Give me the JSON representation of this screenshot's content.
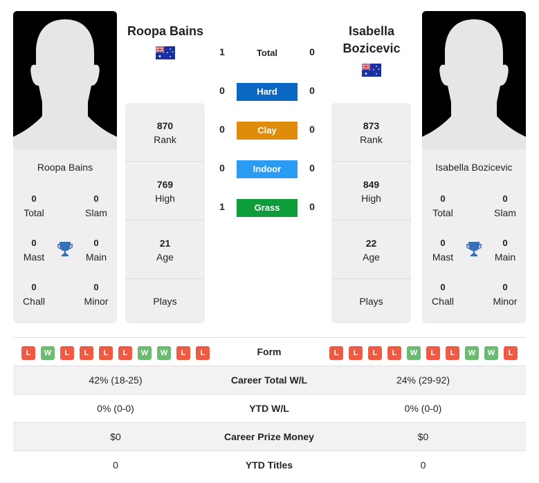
{
  "colors": {
    "hard": "#0a67c2",
    "clay": "#e08c0b",
    "indoor": "#2b9cf4",
    "grass": "#0f9d3c",
    "loss": "#ee5b45",
    "win": "#6dbb73",
    "trophy": "#3a6fba"
  },
  "player1": {
    "name": "Roopa Bains",
    "card_name": "Roopa Bains",
    "country_flag": "australia-flag",
    "rank": "870",
    "rank_label": "Rank",
    "high": "769",
    "high_label": "High",
    "age": "21",
    "age_label": "Age",
    "plays_label": "Plays",
    "titles": {
      "total": "0",
      "total_label": "Total",
      "slam": "0",
      "slam_label": "Slam",
      "mast": "0",
      "mast_label": "Mast",
      "main": "0",
      "main_label": "Main",
      "chall": "0",
      "chall_label": "Chall",
      "minor": "0",
      "minor_label": "Minor"
    },
    "form": [
      "L",
      "W",
      "L",
      "L",
      "L",
      "L",
      "W",
      "W",
      "L",
      "L"
    ],
    "career_wl": "42% (18-25)",
    "ytd_wl": "0% (0-0)",
    "prize": "$0",
    "ytd_titles": "0"
  },
  "player2": {
    "name_line1": "Isabella",
    "name_line2": "Bozicevic",
    "card_name": "Isabella Bozicevic",
    "country_flag": "australia-flag",
    "rank": "873",
    "rank_label": "Rank",
    "high": "849",
    "high_label": "High",
    "age": "22",
    "age_label": "Age",
    "plays_label": "Plays",
    "titles": {
      "total": "0",
      "total_label": "Total",
      "slam": "0",
      "slam_label": "Slam",
      "mast": "0",
      "mast_label": "Mast",
      "main": "0",
      "main_label": "Main",
      "chall": "0",
      "chall_label": "Chall",
      "minor": "0",
      "minor_label": "Minor"
    },
    "form": [
      "L",
      "L",
      "L",
      "L",
      "W",
      "L",
      "L",
      "W",
      "W",
      "L"
    ],
    "career_wl": "24% (29-92)",
    "ytd_wl": "0% (0-0)",
    "prize": "$0",
    "ytd_titles": "0"
  },
  "h2h": {
    "total": {
      "label": "Total",
      "p1": "1",
      "p2": "0"
    },
    "hard": {
      "label": "Hard",
      "p1": "0",
      "p2": "0"
    },
    "clay": {
      "label": "Clay",
      "p1": "0",
      "p2": "0"
    },
    "indoor": {
      "label": "Indoor",
      "p1": "0",
      "p2": "0"
    },
    "grass": {
      "label": "Grass",
      "p1": "1",
      "p2": "0"
    }
  },
  "table": {
    "form_label": "Form",
    "career_label": "Career Total W/L",
    "ytd_label": "YTD W/L",
    "prize_label": "Career Prize Money",
    "titles_label": "YTD Titles"
  }
}
